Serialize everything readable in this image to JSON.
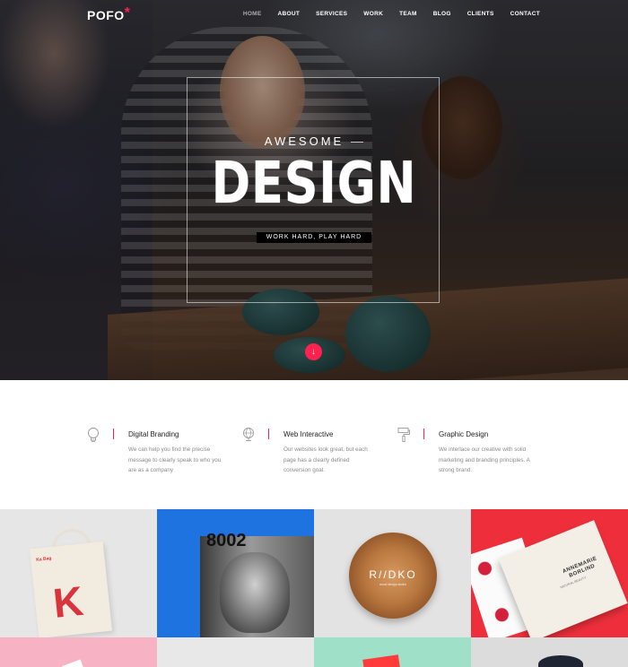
{
  "nav": {
    "logo": "POFO",
    "logo_mark": "*",
    "items": [
      {
        "label": "HOME",
        "active": true
      },
      {
        "label": "ABOUT",
        "active": false
      },
      {
        "label": "SERVICES",
        "active": false
      },
      {
        "label": "WORK",
        "active": false
      },
      {
        "label": "TEAM",
        "active": false
      },
      {
        "label": "BLOG",
        "active": false
      },
      {
        "label": "CLIENTS",
        "active": false
      },
      {
        "label": "CONTACT",
        "active": false
      }
    ]
  },
  "hero": {
    "subtitle": "AWESOME",
    "title": "DESIGN",
    "tagline": "WORK HARD, PLAY HARD",
    "scroll_icon": "arrow-down-icon"
  },
  "features": [
    {
      "icon": "lightbulb-icon",
      "title": "Digital Branding",
      "description": "We can help you find the precise message to clearly speak to who you are as a company"
    },
    {
      "icon": "globe-icon",
      "title": "Web Interactive",
      "description": "Our websites look great, but each page has a clearly defined conversion goal."
    },
    {
      "icon": "paint-roller-icon",
      "title": "Graphic Design",
      "description": "We interlace our creative with solid marketing and branding principles. A strong brand."
    }
  ],
  "portfolio": {
    "tiles": [
      {
        "name": "tote-bag",
        "mark": "K",
        "label": "Ka Bag"
      },
      {
        "name": "magazine",
        "text": "8002"
      },
      {
        "name": "wood-logo",
        "text": "R//DKO",
        "sub": "wood design studio"
      },
      {
        "name": "box",
        "text": "ANNEMARIE BORLIND",
        "sub": "NATURAL BEAUTY"
      }
    ]
  },
  "colors": {
    "accent": "#ff214f",
    "text_dark": "#232323",
    "text_muted": "#8a8a8a"
  }
}
